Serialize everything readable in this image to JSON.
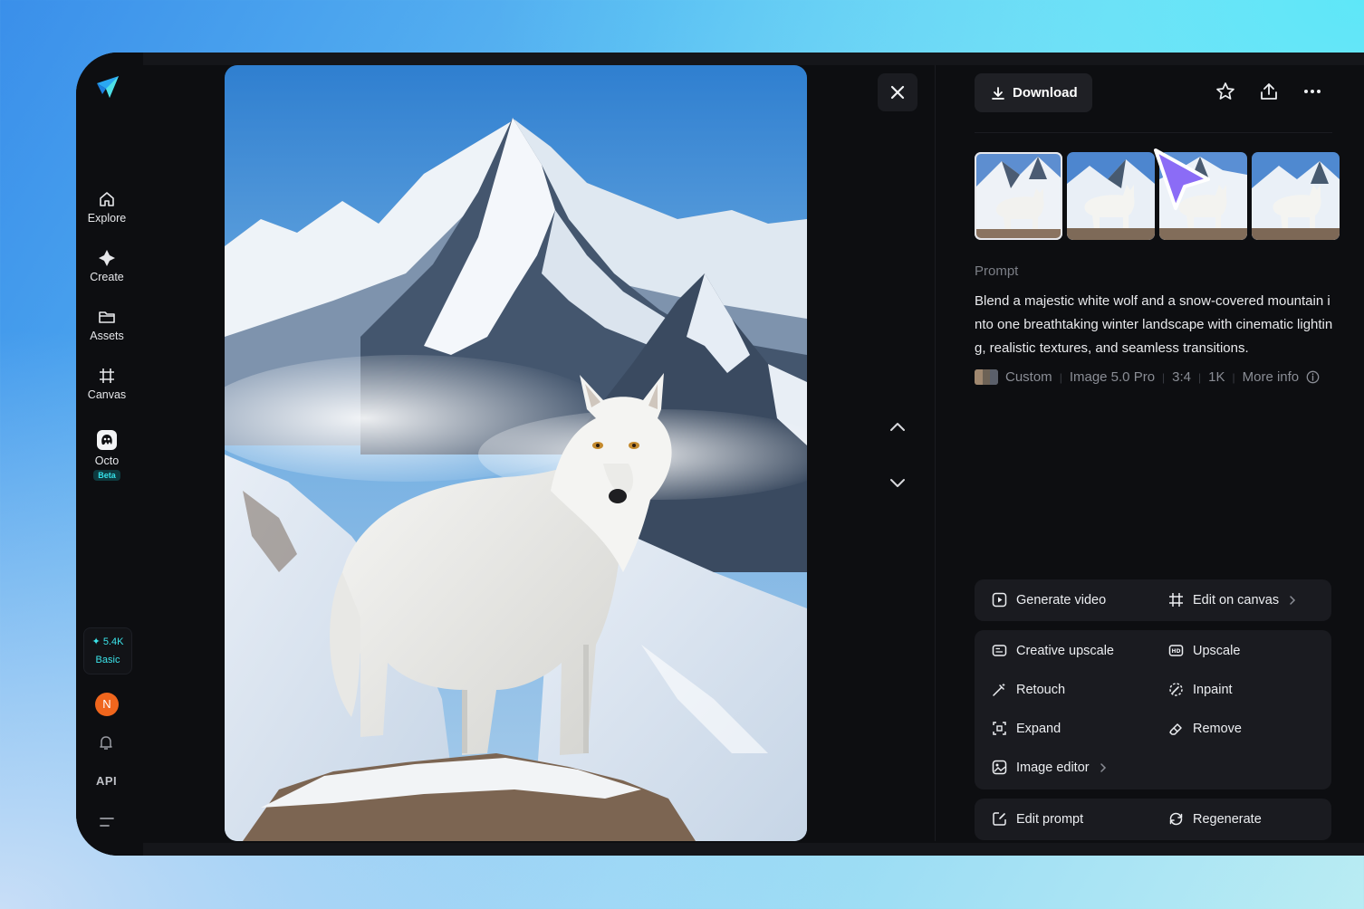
{
  "sidebar": {
    "items": [
      {
        "label": "Explore",
        "icon": "home-icon"
      },
      {
        "label": "Create",
        "icon": "sparkle-icon"
      },
      {
        "label": "Assets",
        "icon": "folder-icon"
      },
      {
        "label": "Canvas",
        "icon": "canvas-icon"
      },
      {
        "label": "Octo",
        "icon": "octo-icon",
        "badge": "Beta"
      }
    ],
    "credits": {
      "value": "5.4K",
      "plan": "Basic"
    },
    "avatar_initial": "N",
    "api_label": "API"
  },
  "viewer": {
    "download_label": "Download"
  },
  "details": {
    "prompt_heading": "Prompt",
    "prompt_text": "Blend a majestic white wolf and a snow-covered mountain into one breathtaking winter landscape with cinematic lighting, realistic textures, and seamless transitions.",
    "meta": {
      "style": "Custom",
      "model": "Image 5.0 Pro",
      "ratio": "3:4",
      "resolution": "1K",
      "more": "More info"
    }
  },
  "actions": {
    "generate_video": "Generate video",
    "edit_on_canvas": "Edit on canvas",
    "creative_upscale": "Creative upscale",
    "upscale": "Upscale",
    "retouch": "Retouch",
    "inpaint": "Inpaint",
    "expand": "Expand",
    "remove": "Remove",
    "image_editor": "Image editor",
    "edit_prompt": "Edit prompt",
    "regenerate": "Regenerate"
  },
  "colors": {
    "accent_cyan": "#35e0e8",
    "cursor_purple": "#8b6cf6",
    "avatar_orange": "#f0661d"
  }
}
